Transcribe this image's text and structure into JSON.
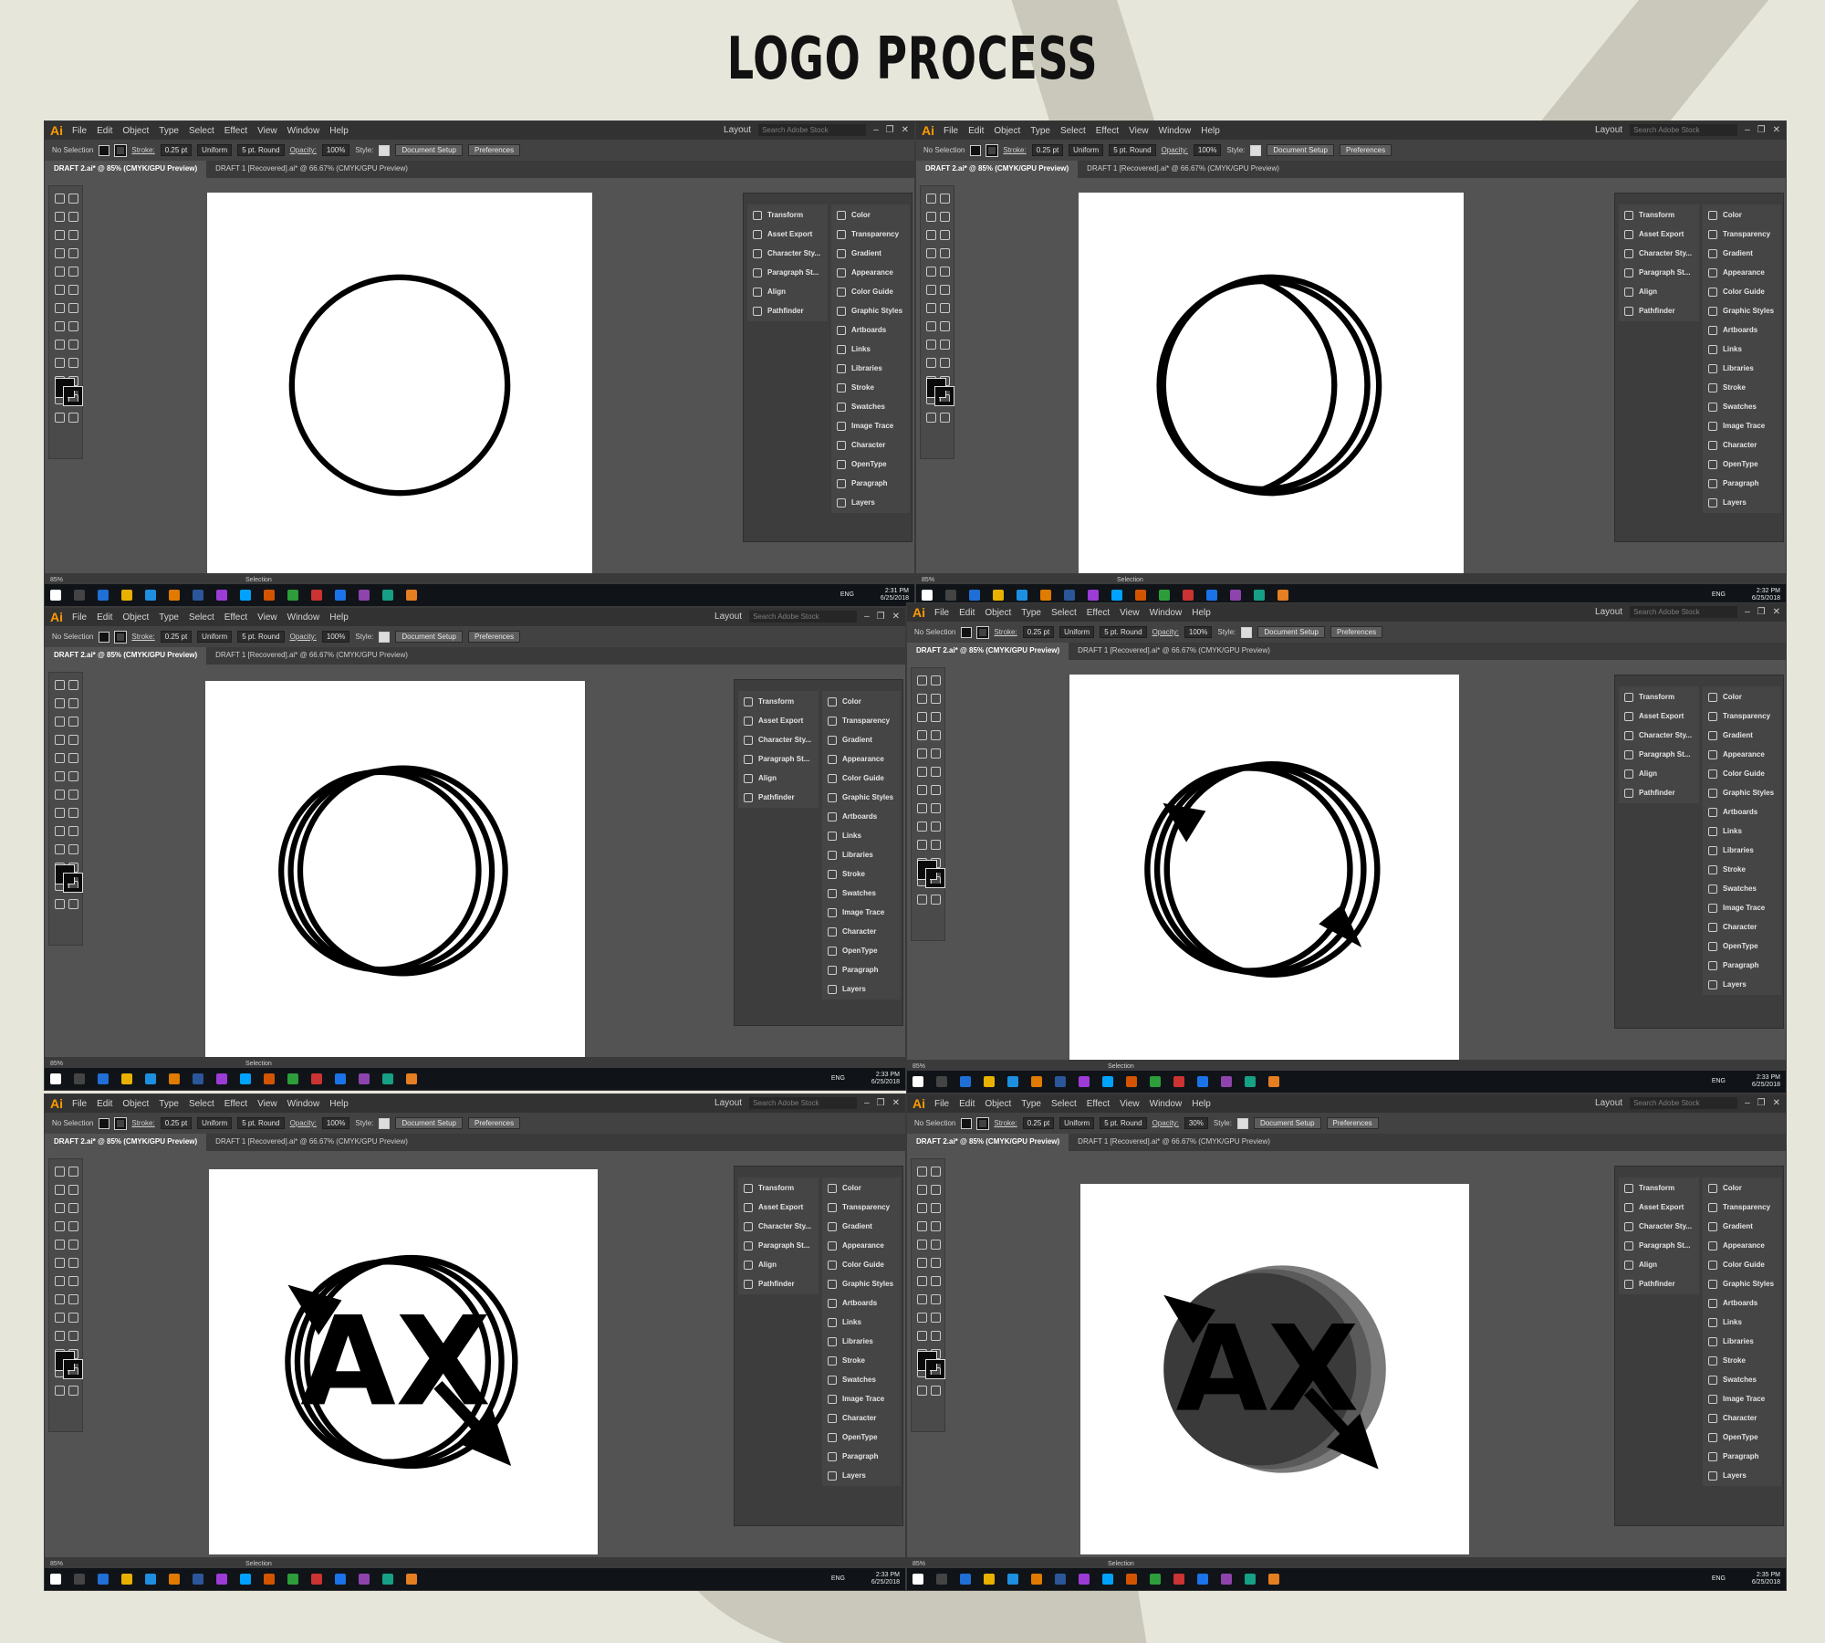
{
  "title": "LOGO PROCESS",
  "app": {
    "logo": "Ai",
    "menus": [
      "File",
      "Edit",
      "Object",
      "Type",
      "Select",
      "Effect",
      "View",
      "Window",
      "Help"
    ],
    "workspace": "Layout",
    "search_placeholder": "Search Adobe Stock",
    "control": {
      "selection": "No Selection",
      "stroke_label": "Stroke:",
      "stroke_value": "0.25 pt",
      "profile": "Uniform",
      "brush": "5 pt. Round",
      "opacity_label": "Opacity:",
      "style_label": "Style:",
      "doc_setup": "Document Setup",
      "preferences": "Preferences"
    },
    "tabs": [
      "DRAFT 2.ai* @ 85% (CMYK/GPU Preview)",
      "DRAFT 1 [Recovered].ai* @ 66.67% (CMYK/GPU Preview)"
    ],
    "panels_left": [
      "Transform",
      "Asset Export",
      "Character Sty...",
      "Paragraph St...",
      "Align",
      "Pathfinder"
    ],
    "panels_right": [
      "Color",
      "Transparency",
      "Gradient",
      "Appearance",
      "Color Guide",
      "Graphic Styles",
      "Artboards",
      "Links",
      "Libraries",
      "Stroke",
      "Swatches",
      "Image Trace",
      "Character",
      "OpenType",
      "Paragraph",
      "Layers"
    ],
    "status": {
      "zoom": "85%",
      "tool": "Selection"
    },
    "tray": {
      "lang": "ENG",
      "date": "6/25/2018"
    }
  },
  "screens": [
    {
      "time": "2:31 PM",
      "opacity": "100%",
      "step": 1,
      "artwork_text": ""
    },
    {
      "time": "2:32 PM",
      "opacity": "100%",
      "step": 2,
      "artwork_text": ""
    },
    {
      "time": "2:33 PM",
      "opacity": "100%",
      "step": 3,
      "artwork_text": ""
    },
    {
      "time": "2:33 PM",
      "opacity": "100%",
      "step": 4,
      "artwork_text": ""
    },
    {
      "time": "2:33 PM",
      "opacity": "100%",
      "step": 5,
      "artwork_text": "AX"
    },
    {
      "time": "2:35 PM",
      "opacity": "30%",
      "step": 6,
      "artwork_text": "AX"
    }
  ],
  "colors": {
    "background": "#e7e6da",
    "ui_dark": "#323232",
    "ui_mid": "#535353",
    "accent": "#ff9a00",
    "ink": "#000000"
  }
}
